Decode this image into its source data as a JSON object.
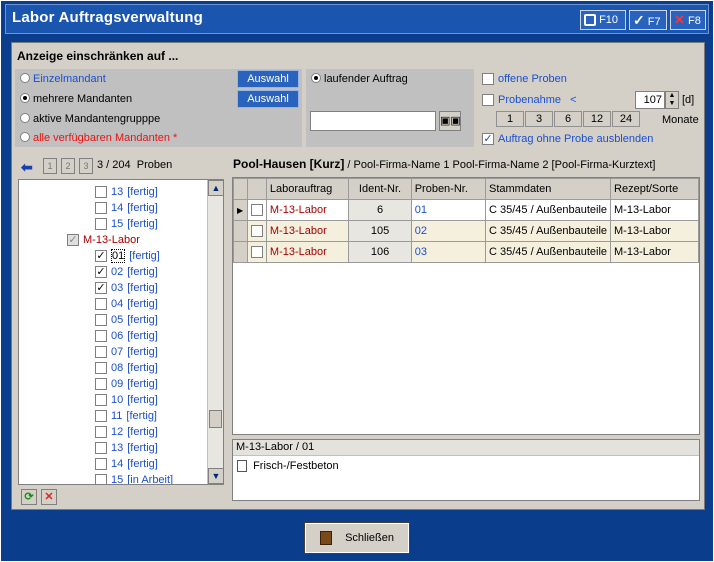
{
  "window": {
    "title": "Labor Auftragsverwaltung",
    "buttons": [
      {
        "label": "F10",
        "icon": "tools-icon"
      },
      {
        "label": "F7",
        "icon": "checkmark-icon"
      },
      {
        "label": "F8",
        "icon": "close-x-icon"
      }
    ]
  },
  "filter": {
    "header": "Anzeige einschränken auf ...",
    "options": [
      {
        "label": "Einzelmandant",
        "selected": false
      },
      {
        "label": "mehrere Mandanten",
        "selected": true
      },
      {
        "label": "aktive Mandantengrupppe",
        "selected": false
      },
      {
        "label": "alle verfügbaren Mandanten *",
        "selected": false
      }
    ],
    "auswahl1": "Auswahl",
    "auswahl2": "Auswahl",
    "running_order": "laufender Auftrag",
    "search_value": "",
    "open_samples": "offene Proben",
    "sampling": "Probenahme",
    "sampling_arrow": "<",
    "sampling_value": "107",
    "sampling_unit": "[d]",
    "months_label": "Monate",
    "periods": [
      "1",
      "3",
      "6",
      "12",
      "24"
    ],
    "hide_without_sample": "Auftrag ohne Probe ausblenden"
  },
  "tree": {
    "counter": "3 / 204",
    "counter_suffix": "Proben",
    "nav_buttons": [
      "1",
      "2",
      "3"
    ],
    "items": [
      {
        "label": "13",
        "status": "[fertig]",
        "checked": false,
        "level": 2
      },
      {
        "label": "14",
        "status": "[fertig]",
        "checked": false,
        "level": 2
      },
      {
        "label": "15",
        "status": "[fertig]",
        "checked": false,
        "level": 2
      },
      {
        "label": "M-13-Labor",
        "status": "",
        "checked": true,
        "level": 1
      },
      {
        "label": "01",
        "status": "[fertig]",
        "checked": true,
        "level": 2
      },
      {
        "label": "02",
        "status": "[fertig]",
        "checked": true,
        "level": 2
      },
      {
        "label": "03",
        "status": "[fertig]",
        "checked": true,
        "level": 2
      },
      {
        "label": "04",
        "status": "[fertig]",
        "checked": false,
        "level": 2
      },
      {
        "label": "05",
        "status": "[fertig]",
        "checked": false,
        "level": 2
      },
      {
        "label": "06",
        "status": "[fertig]",
        "checked": false,
        "level": 2
      },
      {
        "label": "07",
        "status": "[fertig]",
        "checked": false,
        "level": 2
      },
      {
        "label": "08",
        "status": "[fertig]",
        "checked": false,
        "level": 2
      },
      {
        "label": "09",
        "status": "[fertig]",
        "checked": false,
        "level": 2
      },
      {
        "label": "10",
        "status": "[fertig]",
        "checked": false,
        "level": 2
      },
      {
        "label": "11",
        "status": "[fertig]",
        "checked": false,
        "level": 2
      },
      {
        "label": "12",
        "status": "[fertig]",
        "checked": false,
        "level": 2
      },
      {
        "label": "13",
        "status": "[fertig]",
        "checked": false,
        "level": 2
      },
      {
        "label": "14",
        "status": "[fertig]",
        "checked": false,
        "level": 2
      },
      {
        "label": "15",
        "status": "[in Arbeit]",
        "checked": false,
        "level": 2
      }
    ]
  },
  "pool": {
    "title_bold": "Pool-Hausen  [Kurz]",
    "title_rest": " / Pool-Firma-Name 1 Pool-Firma-Name 2  [Pool-Firma-Kurztext]"
  },
  "grid": {
    "columns": [
      "Laborauftrag",
      "Ident-Nr.",
      "Proben-Nr.",
      "Stammdaten",
      "Rezept/Sorte"
    ],
    "rows": [
      [
        "M-13-Labor",
        "6",
        "01",
        "C 35/45 / Außenbauteile",
        "M-13-Labor"
      ],
      [
        "M-13-Labor",
        "105",
        "02",
        "C 35/45 / Außenbauteile",
        "M-13-Labor"
      ],
      [
        "M-13-Labor",
        "106",
        "03",
        "C 35/45 / Außenbauteile",
        "M-13-Labor"
      ]
    ]
  },
  "detail": {
    "header": "M-13-Labor / 01",
    "item": "Frisch-/Festbeton"
  },
  "footer": {
    "close_label": "Schließen"
  }
}
